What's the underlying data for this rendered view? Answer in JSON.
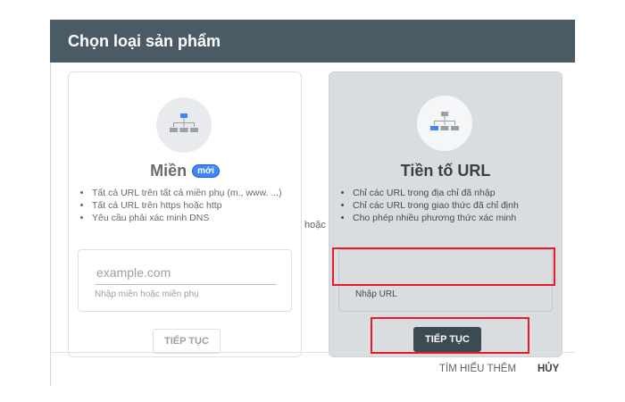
{
  "dialog": {
    "title": "Chọn loại sản phẩm",
    "or_label": "hoặc",
    "footer": {
      "learn_more": "TÌM HIỂU THÊM",
      "cancel": "HỦY"
    }
  },
  "domain_card": {
    "title": "Miền",
    "badge": "mới",
    "icon": "sitemap-icon",
    "bullets": [
      "Tất cả URL trên tất cả miền phụ (m., www. ...)",
      "Tất cả URL trên https hoặc http",
      "Yêu cầu phải xác minh DNS"
    ],
    "input": {
      "placeholder": "example.com",
      "value": "",
      "helper": "Nhập miền hoặc miền phụ"
    },
    "button": "TIẾP TỤC"
  },
  "url_prefix_card": {
    "title": "Tiền tố URL",
    "icon": "sitemap-icon",
    "bullets": [
      "Chỉ các URL trong địa chỉ đã nhập",
      "Chỉ các URL trong giao thức đã chỉ định",
      "Cho phép nhiều phương thức xác minh"
    ],
    "input": {
      "placeholder": "",
      "value": "",
      "helper": "Nhập URL"
    },
    "button": "TIẾP TỤC"
  },
  "colors": {
    "header": "#4a5b66",
    "accent_blue": "#4285f4",
    "highlight": "#e8192c",
    "dark_button": "#3c4a52"
  }
}
